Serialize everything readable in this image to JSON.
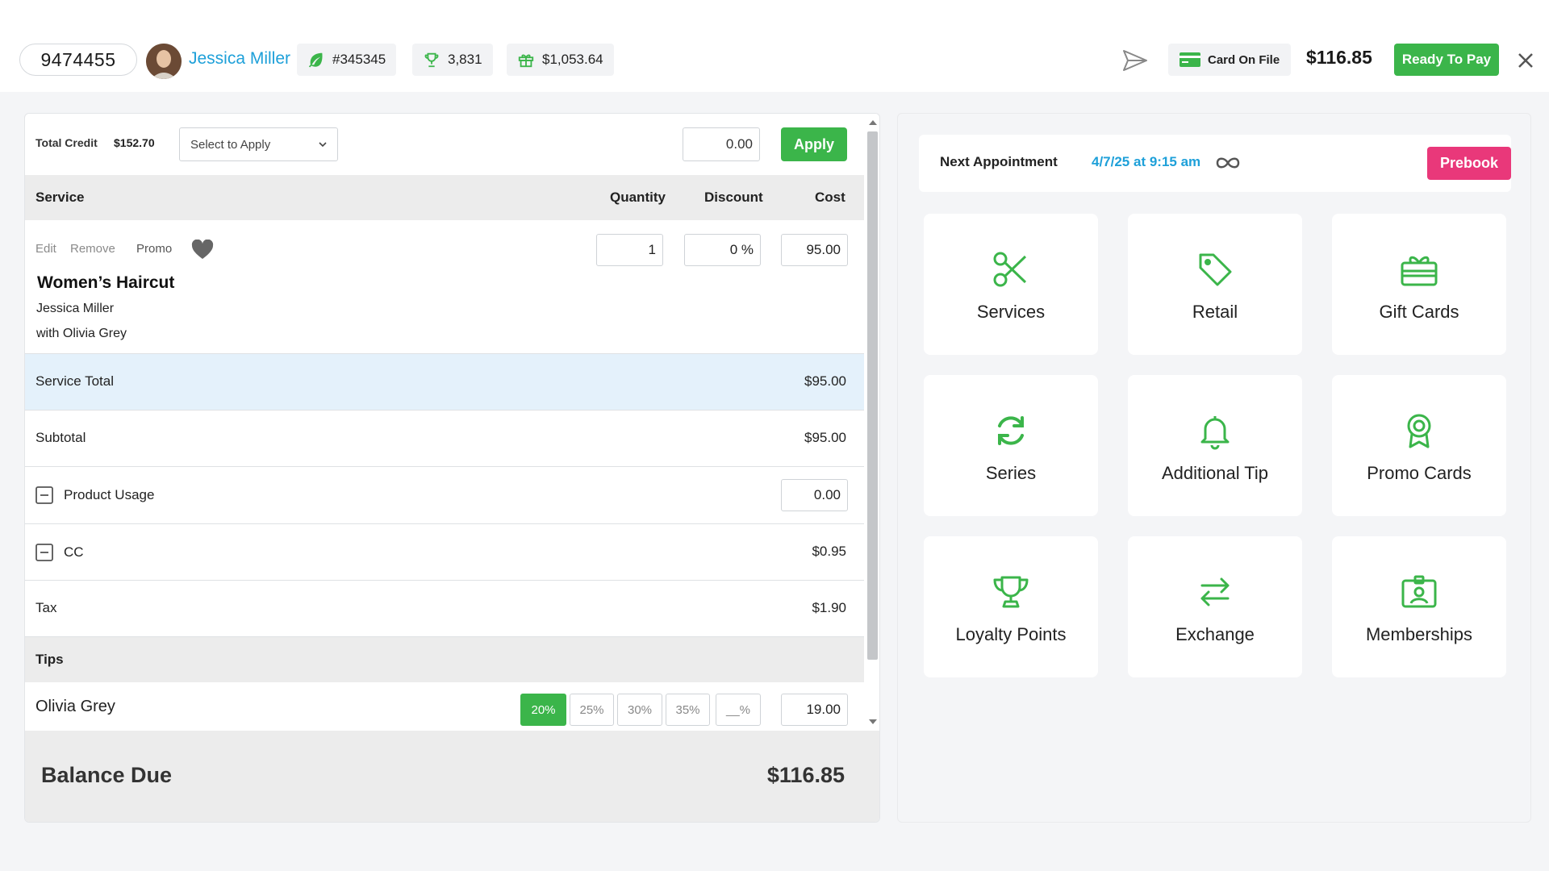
{
  "header": {
    "client_id": "9474455",
    "client_name": "Jessica Miller",
    "ticket_number": "#345345",
    "loyalty_points": "3,831",
    "gift_balance": "$1,053.64",
    "card_status": "Card On File",
    "total_amount": "$116.85",
    "ready_to_pay_label": "Ready To Pay"
  },
  "credit": {
    "label": "Total Credit",
    "value": "$152.70",
    "select_placeholder": "Select to Apply",
    "amount": "0.00",
    "apply_label": "Apply"
  },
  "table": {
    "headers": {
      "service": "Service",
      "quantity": "Quantity",
      "discount": "Discount",
      "cost": "Cost"
    }
  },
  "service_item": {
    "edit_label": "Edit",
    "remove_label": "Remove",
    "promo_label": "Promo",
    "name": "Women’s Haircut",
    "client": "Jessica Miller",
    "stylist": "with Olivia Grey",
    "quantity": "1",
    "discount": "0 %",
    "cost": "95.00"
  },
  "summary": {
    "service_total_label": "Service Total",
    "service_total_value": "$95.00",
    "subtotal_label": "Subtotal",
    "subtotal_value": "$95.00",
    "product_usage_label": "Product Usage",
    "product_usage_value": "0.00",
    "cc_label": "CC",
    "cc_value": "$0.95",
    "tax_label": "Tax",
    "tax_value": "$1.90"
  },
  "tips": {
    "header": "Tips",
    "staff_name": "Olivia Grey",
    "options": [
      "20%",
      "25%",
      "30%",
      "35%",
      "__%"
    ],
    "selected": "20%",
    "amount": "19.00"
  },
  "balance": {
    "label": "Balance Due",
    "value": "$116.85"
  },
  "next_appointment": {
    "label": "Next Appointment",
    "date": "4/7/25 at 9:15 am",
    "prebook_label": "Prebook"
  },
  "tiles": [
    {
      "label": "Services",
      "icon": "scissors-icon"
    },
    {
      "label": "Retail",
      "icon": "tag-icon"
    },
    {
      "label": "Gift Cards",
      "icon": "gift-card-icon"
    },
    {
      "label": "Series",
      "icon": "refresh-icon"
    },
    {
      "label": "Additional Tip",
      "icon": "bell-icon"
    },
    {
      "label": "Promo Cards",
      "icon": "award-icon"
    },
    {
      "label": "Loyalty Points",
      "icon": "trophy-icon"
    },
    {
      "label": "Exchange",
      "icon": "exchange-icon"
    },
    {
      "label": "Memberships",
      "icon": "membership-card-icon"
    }
  ],
  "colors": {
    "accent_green": "#3bb54a",
    "link_blue": "#1ea0d9",
    "prebook_pink": "#e9387a",
    "highlight_row": "#e4f1fb"
  }
}
